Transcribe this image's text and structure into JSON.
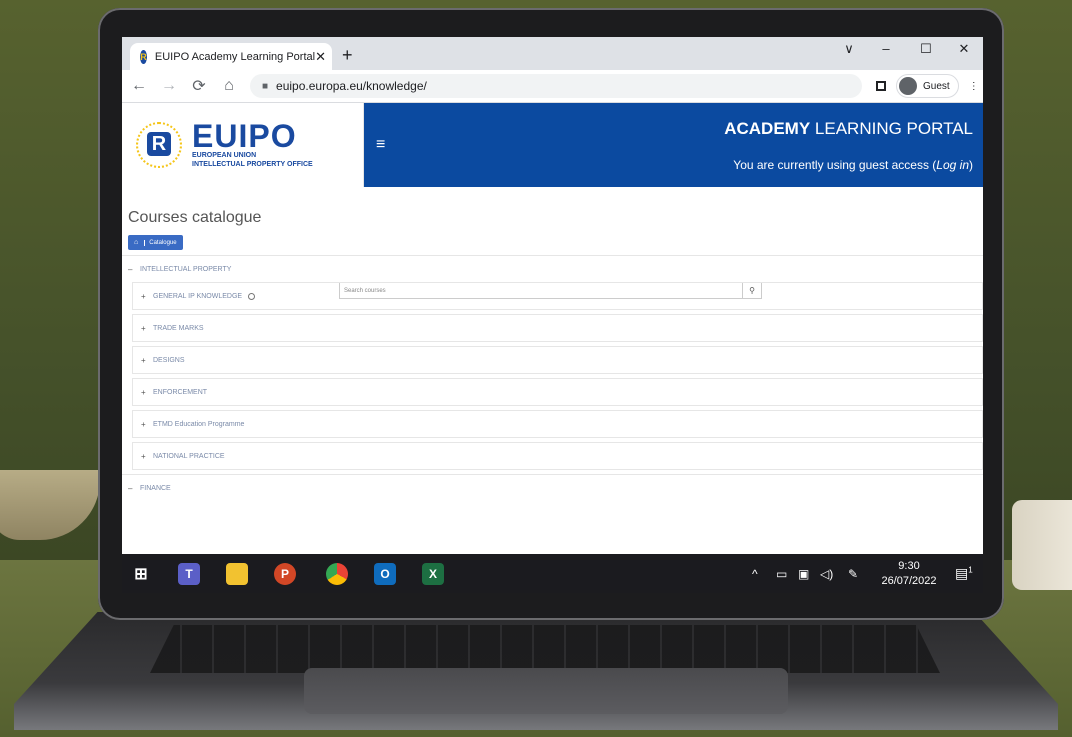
{
  "browser": {
    "tab_title": "EUIPO Academy Learning Portal",
    "favicon_glyph": "R",
    "tab_close": "✕",
    "new_tab": "+",
    "url": "euipo.europa.eu/knowledge/",
    "profile_label": "Guest",
    "window_controls": [
      "∨",
      "–",
      "☐",
      "✕"
    ],
    "nav_icons": [
      "back-arrow-icon",
      "forward-arrow-icon",
      "reload-icon",
      "home-icon"
    ]
  },
  "header": {
    "logo_big": "EUIPO",
    "logo_small_1": "EUROPEAN UNION",
    "logo_small_2": "INTELLECTUAL PROPERTY OFFICE",
    "logo_mark": "R",
    "portal_bold": "ACADEMY",
    "portal_rest": "LEARNING PORTAL",
    "guest_text": "You are currently using guest access (",
    "login_link": "Log in",
    "guest_close": ")"
  },
  "page": {
    "title": "Courses catalogue",
    "breadcrumb_item": "Catalogue",
    "search_placeholder": "Search courses"
  },
  "categories": {
    "top1": "INTELLECTUAL PROPERTY",
    "subs": [
      "GENERAL IP KNOWLEDGE",
      "TRADE MARKS",
      "DESIGNS",
      "ENFORCEMENT",
      "ETMD Education Programme",
      "NATIONAL PRACTICE"
    ],
    "top2": "FINANCE",
    "expanded_glyph": "–",
    "collapsed_glyph": "+"
  },
  "taskbar": {
    "time": "9:30",
    "date": "26/07/2022",
    "notification_count": "1"
  },
  "colors": {
    "brand_blue": "#0b4aa0",
    "logo_gold": "#f5c518",
    "category_text": "#7a8aa8"
  }
}
